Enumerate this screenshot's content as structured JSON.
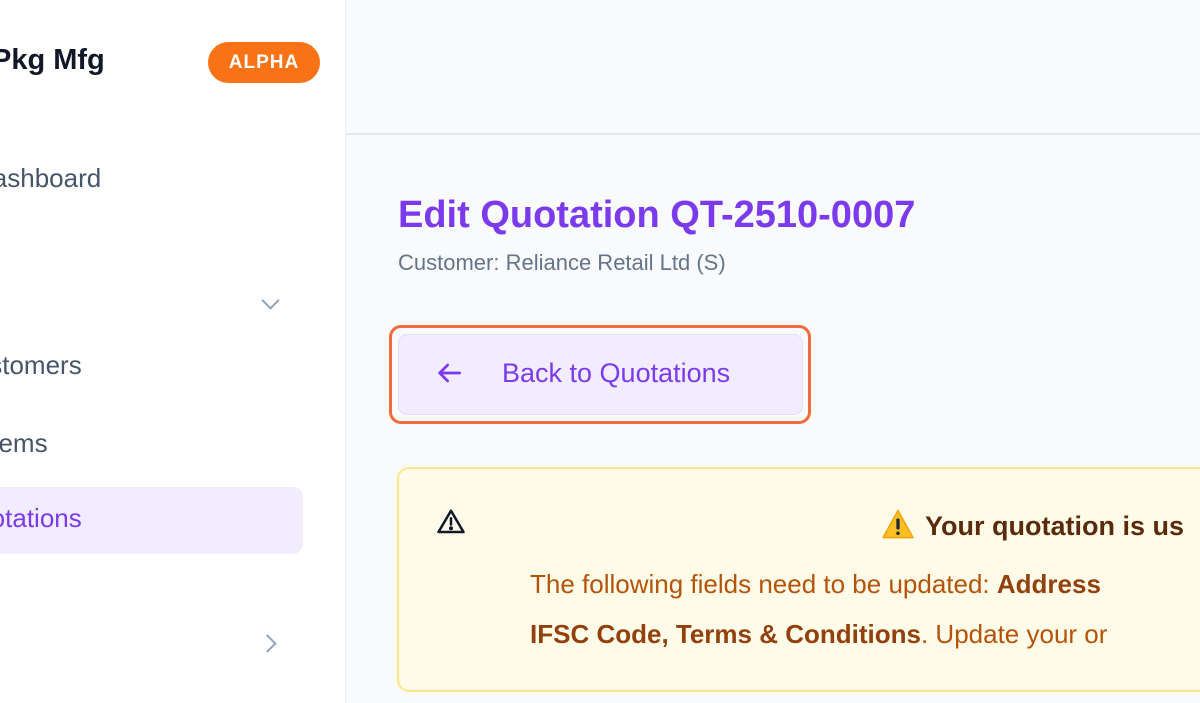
{
  "sidebar": {
    "brand": "Pkg Mfg",
    "badge": "ALPHA",
    "items": [
      {
        "label": "Dashboard"
      },
      {
        "label": ""
      },
      {
        "label": "Customers"
      },
      {
        "label": "Items"
      },
      {
        "label": "Quotations",
        "active": true
      },
      {
        "label": ""
      }
    ]
  },
  "main": {
    "title": "Edit Quotation QT-2510-0007",
    "subtitle": "Customer: Reliance Retail Ltd (S)",
    "back_button": "Back to Quotations",
    "alert": {
      "title": "Your quotation is us",
      "line1_prefix": "The following fields need to be updated: ",
      "line1_bold": "Address",
      "line2_bold": "IFSC Code, Terms & Conditions",
      "line2_suffix": ". Update your or"
    }
  },
  "colors": {
    "accent": "#7c3aed",
    "badge": "#f97316",
    "alert_bg": "#fefce8",
    "alert_border": "#fde68a",
    "focus_ring": "#f26a3d"
  },
  "icons": [
    "chevron-down-icon",
    "chevron-right-icon",
    "arrow-left-icon",
    "warning-outline-icon",
    "warning-emoji-icon"
  ]
}
